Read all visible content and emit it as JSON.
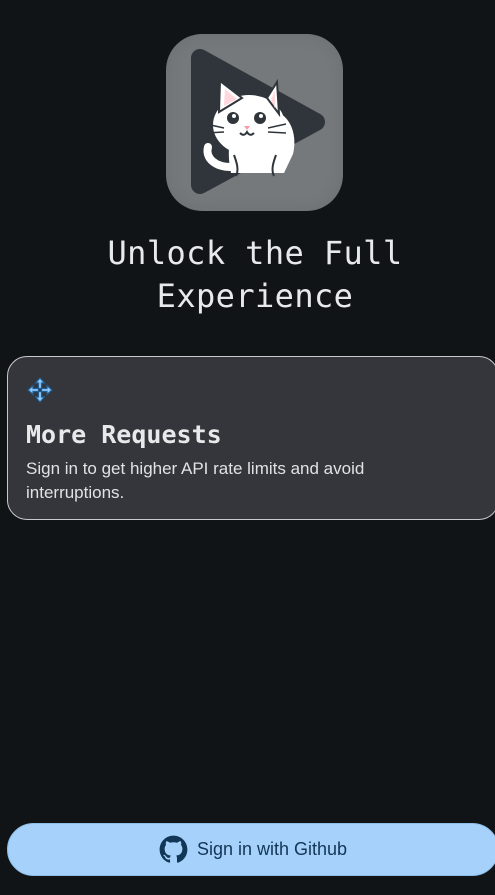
{
  "headline": {
    "line1": "Unlock the Full",
    "line2": "Experience"
  },
  "feature": {
    "icon": "move-arrows-icon",
    "title": "More Requests",
    "description": "Sign in to get higher API rate limits and avoid interruptions."
  },
  "signin": {
    "icon": "github-icon",
    "label": "Sign in with Github"
  },
  "colors": {
    "background": "#111417",
    "card": "#34363b",
    "button": "#a6d1fa",
    "buttonText": "#123656",
    "accentIcon": "#8fc7ff"
  }
}
